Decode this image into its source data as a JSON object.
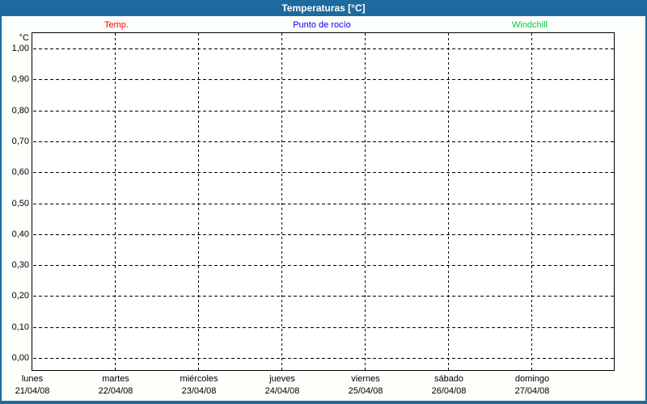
{
  "window": {
    "title": "Temperaturas [°C]"
  },
  "legend": {
    "items": [
      {
        "label": "Temp.",
        "color": "#ff0000"
      },
      {
        "label": "Punto de rocío",
        "color": "#0000ff"
      },
      {
        "label": "Windchill",
        "color": "#00cc44"
      }
    ]
  },
  "chart_data": {
    "type": "line",
    "title": "Temperaturas [°C]",
    "grid": "dashed",
    "legend_position": "top",
    "y_axis": {
      "unit_label": "°C",
      "min": 0.0,
      "max": 1.0,
      "step": 0.1,
      "tick_labels": [
        "0,00",
        "0,10",
        "0,20",
        "0,30",
        "0,40",
        "0,50",
        "0,60",
        "0,70",
        "0,80",
        "0,90",
        "1,00"
      ]
    },
    "x_axis": {
      "days": [
        {
          "day": "lunes",
          "date": "21/04/08"
        },
        {
          "day": "martes",
          "date": "22/04/08"
        },
        {
          "day": "miércoles",
          "date": "23/04/08"
        },
        {
          "day": "jueves",
          "date": "24/04/08"
        },
        {
          "day": "viernes",
          "date": "25/04/08"
        },
        {
          "day": "sábado",
          "date": "26/04/08"
        },
        {
          "day": "domingo",
          "date": "27/04/08"
        }
      ]
    },
    "series": [
      {
        "name": "Temp.",
        "color": "#ff0000",
        "values": []
      },
      {
        "name": "Punto de rocío",
        "color": "#0000ff",
        "values": []
      },
      {
        "name": "Windchill",
        "color": "#00cc44",
        "values": []
      }
    ]
  },
  "colors": {
    "window_chrome": "#1d6a9e",
    "content_background": "#fcfefa",
    "plot_background": "#ffffff",
    "grid": "#000000",
    "text": "#000000",
    "title_text": "#ffffff"
  }
}
